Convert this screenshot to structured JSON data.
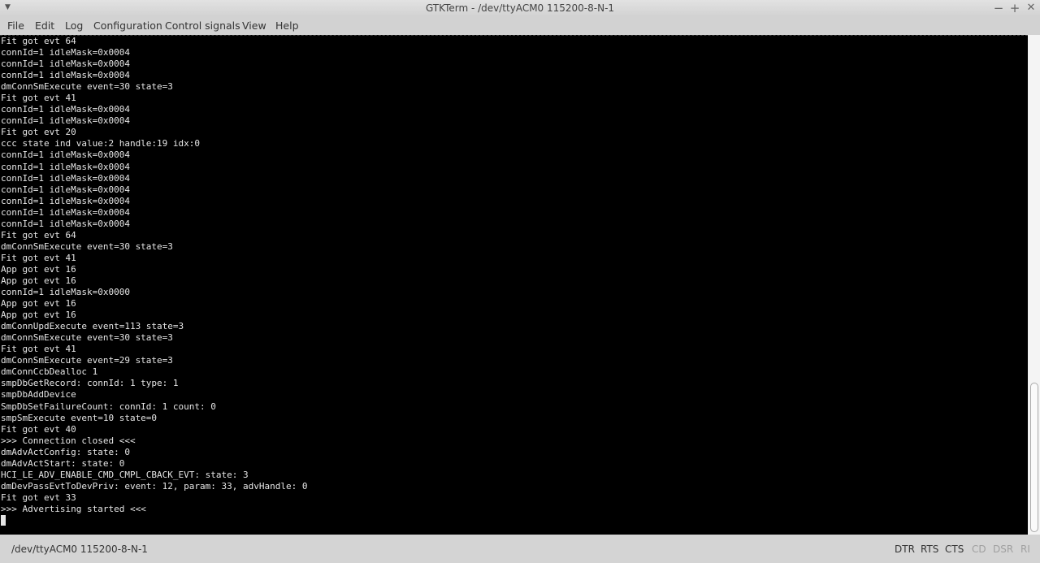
{
  "window": {
    "title": "GTKTerm - /dev/ttyACM0  115200-8-N-1",
    "minimize": "−",
    "maximize": "+",
    "close": "✕"
  },
  "menu": [
    "File",
    "Edit",
    "Log",
    "Configuration",
    "Control signals",
    "View",
    "Help"
  ],
  "terminal": {
    "lines": [
      "Fit got evt 64",
      "connId=1 idleMask=0x0004",
      "connId=1 idleMask=0x0004",
      "connId=1 idleMask=0x0004",
      "dmConnSmExecute event=30 state=3",
      "Fit got evt 41",
      "connId=1 idleMask=0x0004",
      "connId=1 idleMask=0x0004",
      "Fit got evt 20",
      "ccc state ind value:2 handle:19 idx:0",
      "connId=1 idleMask=0x0004",
      "connId=1 idleMask=0x0004",
      "connId=1 idleMask=0x0004",
      "connId=1 idleMask=0x0004",
      "connId=1 idleMask=0x0004",
      "connId=1 idleMask=0x0004",
      "connId=1 idleMask=0x0004",
      "Fit got evt 64",
      "dmConnSmExecute event=30 state=3",
      "Fit got evt 41",
      "App got evt 16",
      "App got evt 16",
      "connId=1 idleMask=0x0000",
      "App got evt 16",
      "App got evt 16",
      "dmConnUpdExecute event=113 state=3",
      "dmConnSmExecute event=30 state=3",
      "Fit got evt 41",
      "dmConnSmExecute event=29 state=3",
      "dmConnCcbDealloc 1",
      "smpDbGetRecord: connId: 1 type: 1",
      "smpDbAddDevice",
      "SmpDbSetFailureCount: connId: 1 count: 0",
      "smpSmExecute event=10 state=0",
      "Fit got evt 40",
      ">>> Connection closed <<<",
      "dmAdvActConfig: state: 0",
      "dmAdvActStart: state: 0",
      "HCI_LE_ADV_ENABLE_CMD_CMPL_CBACK_EVT: state: 3",
      "dmDevPassEvtToDevPriv: event: 12, param: 33, advHandle: 0",
      "Fit got evt 33",
      ">>> Advertising started <<<"
    ],
    "scroll_position": 1.0
  },
  "status": {
    "port": "/dev/ttyACM0  115200-8-N-1",
    "signals": [
      {
        "label": "DTR",
        "active": true
      },
      {
        "label": "RTS",
        "active": true
      },
      {
        "label": "CTS",
        "active": true
      },
      {
        "label": "CD",
        "active": false
      },
      {
        "label": "DSR",
        "active": false
      },
      {
        "label": "RI",
        "active": false
      }
    ],
    "active_color": "#333333",
    "inactive_color": "#a0a0a0"
  }
}
